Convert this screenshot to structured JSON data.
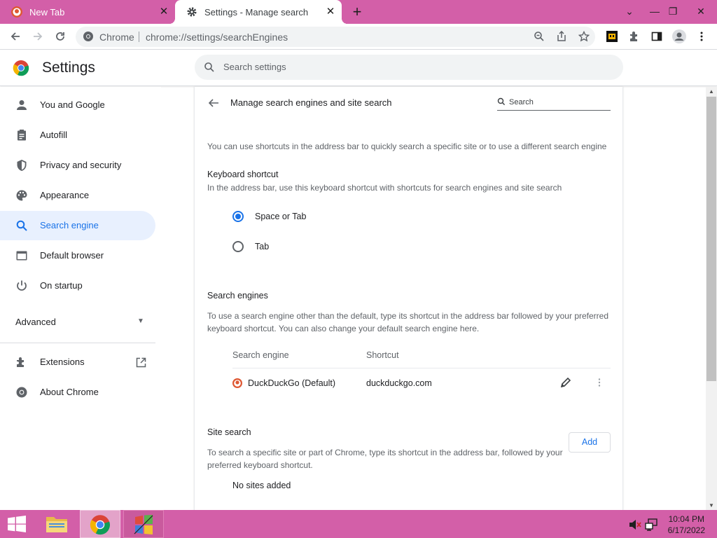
{
  "tabs": [
    {
      "label": "New Tab",
      "active": false
    },
    {
      "label": "Settings - Manage search engine",
      "active": true
    }
  ],
  "toolbar": {
    "omnibox_label": "Chrome",
    "url": "chrome://settings/searchEngines"
  },
  "header": {
    "title": "Settings",
    "search_placeholder": "Search settings"
  },
  "sidebar": {
    "items": [
      {
        "label": "You and Google",
        "icon": "person-icon"
      },
      {
        "label": "Autofill",
        "icon": "clipboard-icon"
      },
      {
        "label": "Privacy and security",
        "icon": "shield-icon"
      },
      {
        "label": "Appearance",
        "icon": "palette-icon"
      },
      {
        "label": "Search engine",
        "icon": "search-icon"
      },
      {
        "label": "Default browser",
        "icon": "browser-icon"
      },
      {
        "label": "On startup",
        "icon": "power-icon"
      }
    ],
    "advanced": "Advanced",
    "extensions": "Extensions",
    "about": "About Chrome"
  },
  "main": {
    "title": "Manage search engines and site search",
    "search_placeholder": "Search",
    "intro": "You can use shortcuts in the address bar to quickly search a specific site or to use a different search engine",
    "keyboard": {
      "heading": "Keyboard shortcut",
      "description": "In the address bar, use this keyboard shortcut with shortcuts for search engines and site search",
      "options": [
        {
          "label": "Space or Tab",
          "selected": true
        },
        {
          "label": "Tab",
          "selected": false
        }
      ]
    },
    "engines": {
      "heading": "Search engines",
      "description_line1": "To use a search engine other than the default, type its shortcut in the address bar followed by your preferred",
      "description_line2": "keyboard shortcut. You can also change your default search engine here.",
      "col_engine": "Search engine",
      "col_shortcut": "Shortcut",
      "rows": [
        {
          "name": "DuckDuckGo (Default)",
          "shortcut": "duckduckgo.com"
        }
      ]
    },
    "site_search": {
      "heading": "Site search",
      "description_line1": "To search a specific site or part of Chrome, type its shortcut in the address bar, followed by your",
      "description_line2": "preferred keyboard shortcut.",
      "add_label": "Add",
      "empty": "No sites added"
    }
  },
  "taskbar": {
    "time": "10:04 PM",
    "date": "6/17/2022"
  },
  "colors": {
    "accent": "#1a73e8",
    "tabstrip": "#d35fa8",
    "active_nav_bg": "#e8f0fe"
  }
}
